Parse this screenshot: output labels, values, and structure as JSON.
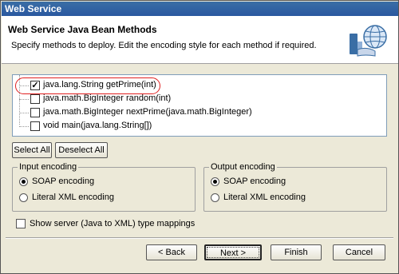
{
  "window": {
    "title": "Web Service"
  },
  "header": {
    "title": "Web Service Java Bean Methods",
    "description": "Specify methods to deploy.  Edit the encoding style for each method if required."
  },
  "methods": [
    {
      "label": "java.lang.String getPrime(int)",
      "checked": true
    },
    {
      "label": "java.math.BigInteger random(int)",
      "checked": false
    },
    {
      "label": "java.math.BigInteger nextPrime(java.math.BigInteger)",
      "checked": false
    },
    {
      "label": "void main(java.lang.String[])",
      "checked": false
    }
  ],
  "actions": {
    "select_all": "Select All",
    "deselect_all": "Deselect All"
  },
  "input_encoding": {
    "legend": "Input encoding",
    "options": [
      "SOAP encoding",
      "Literal XML encoding"
    ],
    "selected": "SOAP encoding"
  },
  "output_encoding": {
    "legend": "Output encoding",
    "options": [
      "SOAP encoding",
      "Literal XML encoding"
    ],
    "selected": "SOAP encoding"
  },
  "server_mapping": {
    "label": "Show server (Java to XML) type mappings",
    "checked": false
  },
  "footer": {
    "back": "< Back",
    "next": "Next >",
    "finish": "Finish",
    "cancel": "Cancel"
  },
  "colors": {
    "highlight": "#e02020",
    "titlebar": "#2a58a0"
  },
  "icons": {
    "header": "globe-hand-icon"
  }
}
